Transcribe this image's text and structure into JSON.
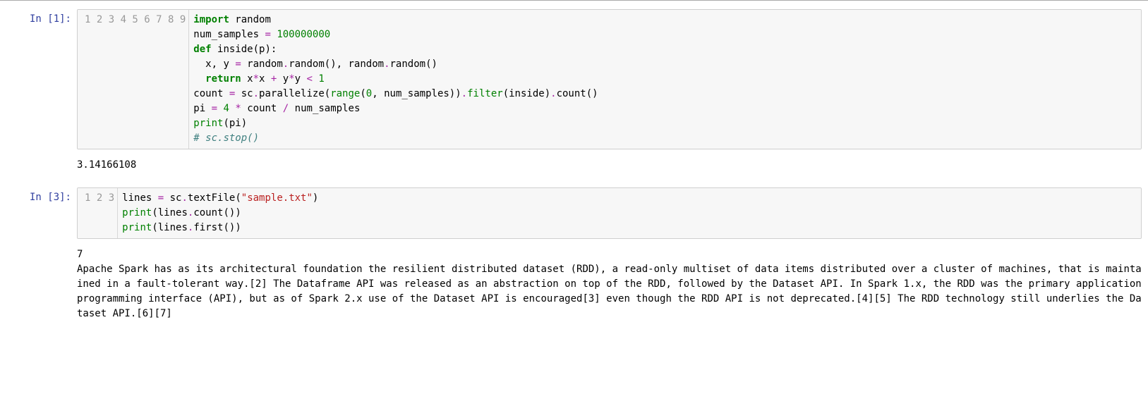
{
  "cells": [
    {
      "prompt": "In [1]:",
      "line_count": 9,
      "code": [
        [
          {
            "t": "import",
            "c": "kw"
          },
          {
            "t": " random",
            "c": "nm"
          }
        ],
        [
          {
            "t": "num_samples ",
            "c": "nm"
          },
          {
            "t": "=",
            "c": "op"
          },
          {
            "t": " ",
            "c": "nm"
          },
          {
            "t": "100000000",
            "c": "num"
          }
        ],
        [
          {
            "t": "def",
            "c": "kw"
          },
          {
            "t": " inside(p):",
            "c": "nm"
          }
        ],
        [
          {
            "t": "  x, y ",
            "c": "nm"
          },
          {
            "t": "=",
            "c": "op"
          },
          {
            "t": " random",
            "c": "nm"
          },
          {
            "t": ".",
            "c": "op"
          },
          {
            "t": "random(), random",
            "c": "nm"
          },
          {
            "t": ".",
            "c": "op"
          },
          {
            "t": "random()",
            "c": "nm"
          }
        ],
        [
          {
            "t": "  ",
            "c": "nm"
          },
          {
            "t": "return",
            "c": "kw"
          },
          {
            "t": " x",
            "c": "nm"
          },
          {
            "t": "*",
            "c": "op"
          },
          {
            "t": "x ",
            "c": "nm"
          },
          {
            "t": "+",
            "c": "op"
          },
          {
            "t": " y",
            "c": "nm"
          },
          {
            "t": "*",
            "c": "op"
          },
          {
            "t": "y ",
            "c": "nm"
          },
          {
            "t": "<",
            "c": "op"
          },
          {
            "t": " ",
            "c": "nm"
          },
          {
            "t": "1",
            "c": "num"
          }
        ],
        [
          {
            "t": "count ",
            "c": "nm"
          },
          {
            "t": "=",
            "c": "op"
          },
          {
            "t": " sc",
            "c": "nm"
          },
          {
            "t": ".",
            "c": "op"
          },
          {
            "t": "parallelize(",
            "c": "nm"
          },
          {
            "t": "range",
            "c": "bi"
          },
          {
            "t": "(",
            "c": "nm"
          },
          {
            "t": "0",
            "c": "num"
          },
          {
            "t": ", num_samples))",
            "c": "nm"
          },
          {
            "t": ".",
            "c": "op"
          },
          {
            "t": "filter",
            "c": "bi"
          },
          {
            "t": "(inside)",
            "c": "nm"
          },
          {
            "t": ".",
            "c": "op"
          },
          {
            "t": "count()",
            "c": "nm"
          }
        ],
        [
          {
            "t": "pi ",
            "c": "nm"
          },
          {
            "t": "=",
            "c": "op"
          },
          {
            "t": " ",
            "c": "nm"
          },
          {
            "t": "4",
            "c": "num"
          },
          {
            "t": " ",
            "c": "nm"
          },
          {
            "t": "*",
            "c": "op"
          },
          {
            "t": " count ",
            "c": "nm"
          },
          {
            "t": "/",
            "c": "op"
          },
          {
            "t": " num_samples",
            "c": "nm"
          }
        ],
        [
          {
            "t": "print",
            "c": "bi"
          },
          {
            "t": "(pi)",
            "c": "nm"
          }
        ],
        [
          {
            "t": "# sc.stop()",
            "c": "cm"
          }
        ]
      ],
      "output": "3.14166108"
    },
    {
      "prompt": "In [3]:",
      "line_count": 3,
      "code": [
        [
          {
            "t": "lines ",
            "c": "nm"
          },
          {
            "t": "=",
            "c": "op"
          },
          {
            "t": " sc",
            "c": "nm"
          },
          {
            "t": ".",
            "c": "op"
          },
          {
            "t": "textFile(",
            "c": "nm"
          },
          {
            "t": "\"sample.txt\"",
            "c": "str"
          },
          {
            "t": ")",
            "c": "nm"
          }
        ],
        [
          {
            "t": "print",
            "c": "bi"
          },
          {
            "t": "(lines",
            "c": "nm"
          },
          {
            "t": ".",
            "c": "op"
          },
          {
            "t": "count())",
            "c": "nm"
          }
        ],
        [
          {
            "t": "print",
            "c": "bi"
          },
          {
            "t": "(lines",
            "c": "nm"
          },
          {
            "t": ".",
            "c": "op"
          },
          {
            "t": "first())",
            "c": "nm"
          }
        ]
      ],
      "output": "7\nApache Spark has as its architectural foundation the resilient distributed dataset (RDD), a read-only multiset of data items distributed over a cluster of machines, that is maintained in a fault-tolerant way.[2] The Dataframe API was released as an abstraction on top of the RDD, followed by the Dataset API. In Spark 1.x, the RDD was the primary application programming interface (API), but as of Spark 2.x use of the Dataset API is encouraged[3] even though the RDD API is not deprecated.[4][5] The RDD technology still underlies the Dataset API.[6][7]"
    }
  ]
}
